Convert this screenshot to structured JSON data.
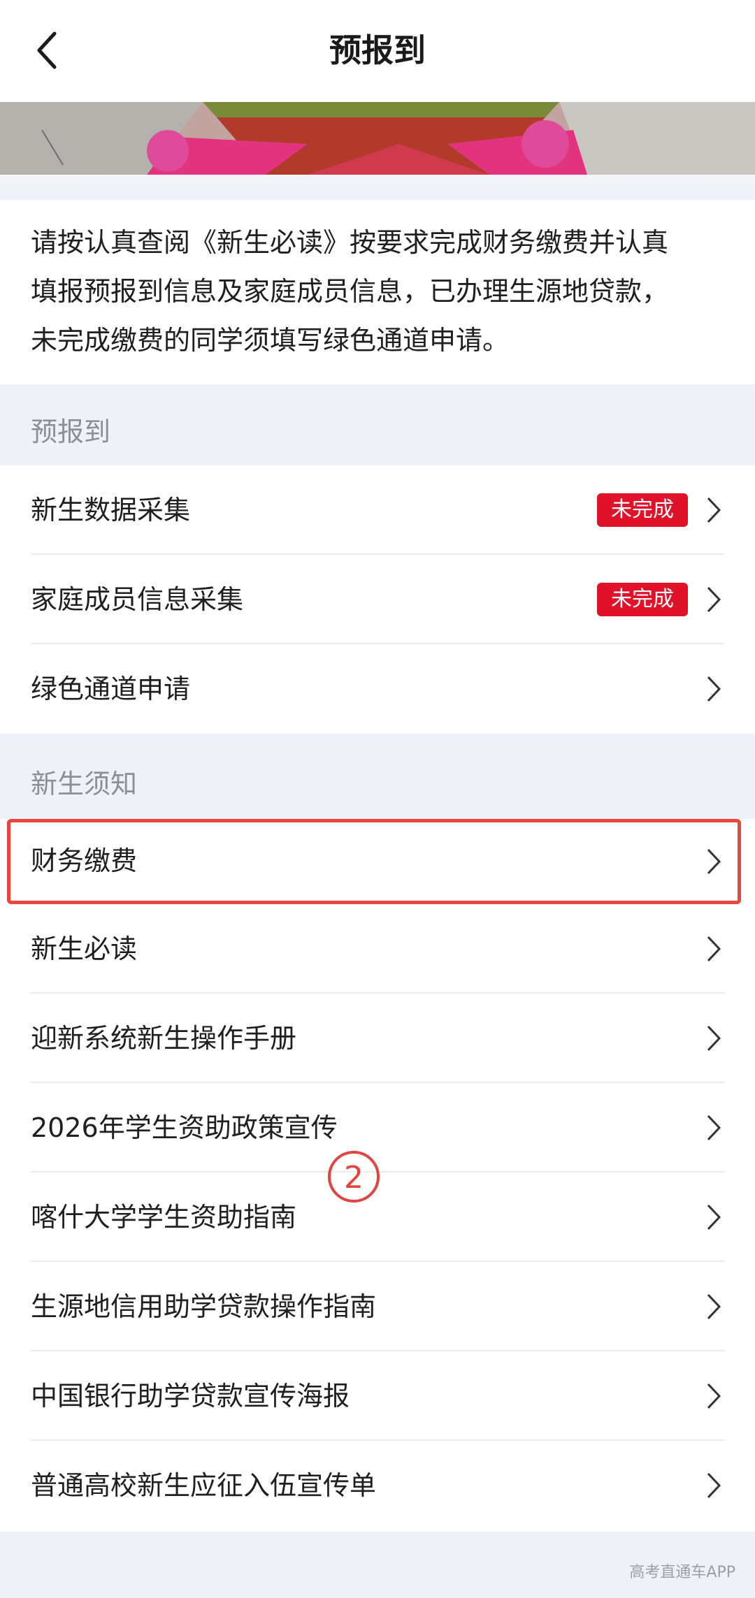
{
  "header": {
    "title": "预报到"
  },
  "intro": {
    "lines": [
      "请按认真查阅《新生必读》按要求完成财务缴费并认真",
      "填报预报到信息及家庭成员信息，已办理生源地贷款，",
      "未完成缴费的同学须填写绿色通道申请。"
    ]
  },
  "sections": {
    "pre_register": {
      "label": "预报到",
      "items": [
        {
          "label": "新生数据采集",
          "badge": "未完成"
        },
        {
          "label": "家庭成员信息采集",
          "badge": "未完成"
        },
        {
          "label": "绿色通道申请"
        }
      ]
    },
    "notices": {
      "label": "新生须知",
      "items": [
        {
          "label": "财务缴费"
        },
        {
          "label": "新生必读"
        },
        {
          "label": "迎新系统新生操作手册"
        },
        {
          "label": "2026年学生资助政策宣传"
        },
        {
          "label": "喀什大学学生资助指南"
        },
        {
          "label": "生源地信用助学贷款操作指南"
        },
        {
          "label": "中国银行助学贷款宣传海报"
        },
        {
          "label": "普通高校新生应征入伍宣传单"
        }
      ]
    }
  },
  "annotation": {
    "step_marker": "②"
  },
  "watermark": {
    "text": "高考直通车APP"
  },
  "colors": {
    "badge": "#e0122a",
    "highlight": "#e8453c",
    "page_bg": "#eef2f8"
  },
  "icons": {
    "back": "chevron-left-icon",
    "row": "chevron-right-icon"
  }
}
